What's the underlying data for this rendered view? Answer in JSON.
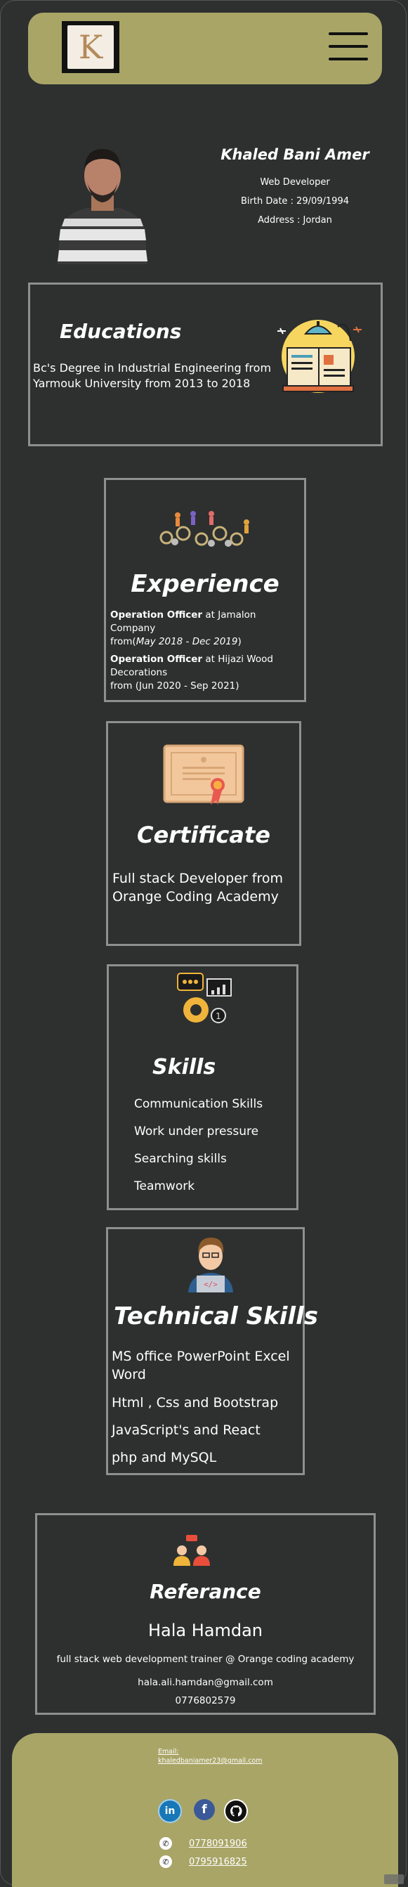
{
  "header": {
    "logo_letter": "K",
    "menu_icon": "hamburger-menu-icon"
  },
  "profile": {
    "name": "Khaled Bani Amer",
    "title": "Web Developer",
    "birth": "Birth Date : 29/09/1994",
    "address": "Address : Jordan"
  },
  "education": {
    "title": "Educations",
    "text": "Bc's Degree in Industrial Engineering from Yarmouk University from 2013 to 2018",
    "icon": "books-lamp-icon"
  },
  "experience": {
    "title": "Experience",
    "icon": "gears-people-icon",
    "job1_role": "Operation Officer",
    "job1_company": " at Jamalon Company",
    "job1_from": "from(",
    "job1_dates": "May 2018 - Dec 2019",
    "job1_close": ")",
    "job2_role": "Operation Officer",
    "job2_company": " at Hijazi Wood Decorations",
    "job2_dates": "from (Jun 2020 - Sep 2021)"
  },
  "certificate": {
    "title": "Certificate",
    "icon": "certificate-icon",
    "text": "Full stack Developer from Orange Coding Academy"
  },
  "skills": {
    "title": "Skills",
    "icon": "skills-gear-chart-icon",
    "items": [
      "Communication Skills",
      "Work under pressure",
      "Searching skills",
      "Teamwork"
    ]
  },
  "tech_skills": {
    "title": "Technical  Skills",
    "icon": "developer-laptop-icon",
    "items": [
      "MS office PowerPoint Excel Word",
      "Html , Css and Bootstrap",
      "JavaScript's and React",
      "php and MySQL"
    ]
  },
  "reference": {
    "title": "Referance",
    "icon": "people-chat-icon",
    "name": "Hala Hamdan",
    "role": "full stack web development trainer @ Orange coding academy",
    "email": "hala.ali.hamdan@gmail.com",
    "phone": "0776802579"
  },
  "footer": {
    "email_label": "Email:",
    "email": "khaledbaniamer23@gmail.com",
    "phone1": "0778091906",
    "phone2": "0795916825",
    "social": [
      "linkedin-icon",
      "facebook-icon",
      "github-icon"
    ],
    "colors": {
      "footer_bg": "#a9a567",
      "page_bg": "#2d302f"
    }
  }
}
